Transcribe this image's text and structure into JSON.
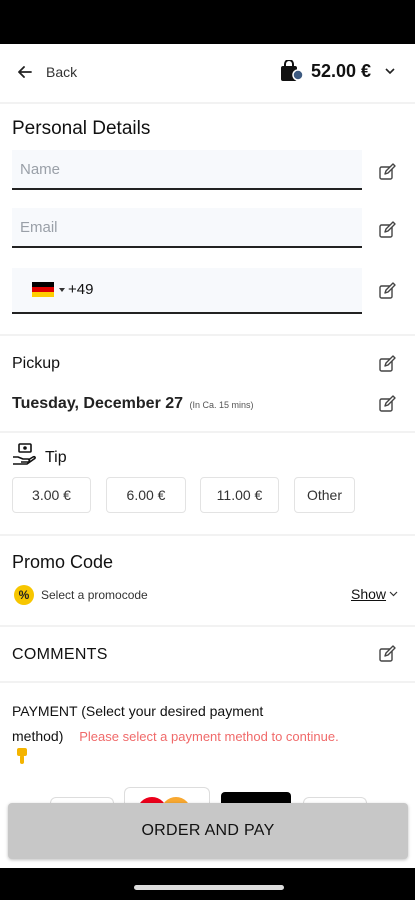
{
  "header": {
    "back_label": "Back",
    "cart_total": "52.00 €"
  },
  "personal": {
    "title": "Personal Details",
    "name_placeholder": "Name",
    "email_placeholder": "Email",
    "phone_code": "+49"
  },
  "pickup": {
    "title": "Pickup",
    "date": "Tuesday, December 27",
    "eta": "(In Ca. 15 mins)"
  },
  "tip": {
    "title": "Tip",
    "options": [
      "3.00 €",
      "6.00 €",
      "11.00 €",
      "Other"
    ]
  },
  "promo": {
    "title": "Promo Code",
    "select_label": "Select a promocode",
    "show_label": "Show"
  },
  "comments": {
    "title": "COMMENTS"
  },
  "payment": {
    "title_line1": "PAYMENT (Select your desired payment",
    "title_line2": "method)",
    "error": "Please select a payment method to continue."
  },
  "order_button": "ORDER AND PAY",
  "colors": {
    "error": "#f06a6a",
    "promo_badge": "#f7c600",
    "order_bg": "#c7c7c7"
  }
}
